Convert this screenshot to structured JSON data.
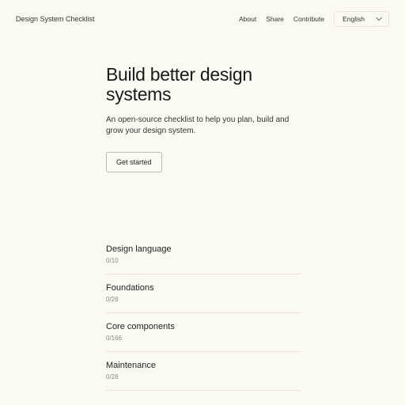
{
  "header": {
    "logo": "Design System Checklist",
    "nav": [
      "About",
      "Share",
      "Contribute"
    ],
    "lang": "English"
  },
  "hero": {
    "title": "Build better design systems",
    "subtitle": "An open-source checklist to help you plan, build and grow your design system.",
    "cta": "Get started"
  },
  "sections": [
    {
      "title": "Design language",
      "count": "0/10"
    },
    {
      "title": "Foundations",
      "count": "0/26"
    },
    {
      "title": "Core components",
      "count": "0/166"
    },
    {
      "title": "Maintenance",
      "count": "0/28"
    }
  ]
}
